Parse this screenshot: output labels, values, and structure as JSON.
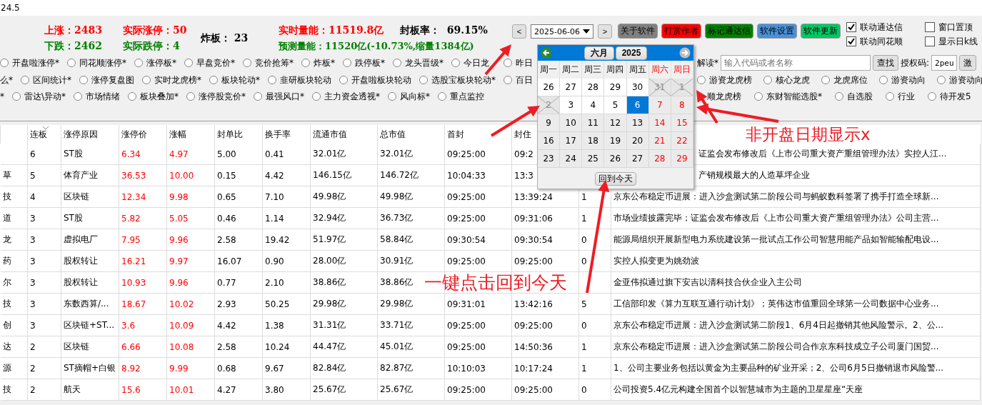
{
  "window": {
    "title": "24.5"
  },
  "market": {
    "rise": {
      "text": "上涨：2483",
      "kind": "up"
    },
    "limit_up": {
      "text": "实际涨停：50",
      "kind": "up"
    },
    "broken": {
      "text": "炸板： 23",
      "kind": "neutral"
    },
    "volume": {
      "text": "实时量能：11519.8亿",
      "kind": "up"
    },
    "seal_rate": {
      "text": "封板率：  69.15%",
      "kind": "neutral"
    },
    "fall": {
      "text": "下跌：2462",
      "kind": "down"
    },
    "limit_down": {
      "text": "实际跌停：4",
      "kind": "down"
    },
    "forecast": {
      "text": "预测量能：11520亿(-10.73%,缩量1384亿)",
      "kind": "down"
    }
  },
  "date_picker": {
    "prev": "<",
    "value": "2025-06-06",
    "next": ">"
  },
  "buttons": [
    {
      "label": "关于软件",
      "color": "#808080"
    },
    {
      "label": "打赏作者",
      "color": "#ff0000"
    },
    {
      "label": "标记通达信",
      "color": "#008000"
    },
    {
      "label": "软件设置",
      "color": "#4a90d9"
    },
    {
      "label": "软件更新",
      "color": "#00c864"
    }
  ],
  "checkboxes": [
    {
      "label": "联动通达信",
      "checked": true
    },
    {
      "label": "联动同花顺",
      "checked": true
    },
    {
      "label": "窗口置顶",
      "checked": false
    },
    {
      "label": "显示日k线",
      "checked": false
    }
  ],
  "radio_rows": [
    {
      "left": [
        {
          "kind": "radio",
          "label": "开盘啦涨停*",
          "selected": false
        },
        {
          "kind": "radio",
          "label": "同花顺涨停*",
          "selected": false
        },
        {
          "kind": "radio",
          "label": "涨停板*",
          "selected": false
        },
        {
          "kind": "radio",
          "label": "早盘竞价*",
          "selected": false
        },
        {
          "kind": "radio",
          "label": "竞价抢筹*",
          "selected": false
        },
        {
          "kind": "radio",
          "label": "炸板*",
          "selected": false
        },
        {
          "kind": "radio",
          "label": "跌停板*",
          "selected": false
        },
        {
          "kind": "radio",
          "label": "龙头晋级*",
          "selected": false
        },
        {
          "kind": "radio",
          "label": "今日龙",
          "selected": false
        },
        {
          "kind": "radio",
          "label": "昨日",
          "selected": false
        }
      ],
      "right": [
        {
          "kind": "text",
          "label": "解读*"
        },
        {
          "kind": "field",
          "placeholder": "输入代码或者名称"
        },
        {
          "kind": "button",
          "label": "查找"
        },
        {
          "kind": "text",
          "label": "授权码:"
        },
        {
          "kind": "field",
          "value": "2peu"
        },
        {
          "kind": "button",
          "label": "激"
        }
      ]
    },
    {
      "left": [
        {
          "kind": "text",
          "label": "么*"
        },
        {
          "kind": "radio",
          "label": "区间统计*",
          "selected": false
        },
        {
          "kind": "radio",
          "label": "涨停复盘图",
          "selected": false
        },
        {
          "kind": "radio",
          "label": "实时龙虎榜*",
          "selected": false
        },
        {
          "kind": "radio",
          "label": "板块轮动*",
          "selected": false
        },
        {
          "kind": "radio",
          "label": "韭研板块轮动",
          "selected": false
        },
        {
          "kind": "radio",
          "label": "开盘啦板块轮动",
          "selected": false
        },
        {
          "kind": "radio",
          "label": "选股宝板块轮动*",
          "selected": false
        },
        {
          "kind": "radio",
          "label": "百日",
          "selected": false
        }
      ],
      "right": [
        {
          "kind": "radio",
          "label": "游资龙虎榜",
          "selected": false
        },
        {
          "kind": "radio",
          "label": "核心龙虎",
          "selected": false
        },
        {
          "kind": "radio",
          "label": "龙虎席位",
          "selected": false
        },
        {
          "kind": "radio",
          "label": "游资动向",
          "selected": false
        },
        {
          "kind": "radio",
          "label": "游资动向",
          "selected": false
        }
      ]
    },
    {
      "left": [
        {
          "kind": "text",
          "label": "*"
        },
        {
          "kind": "radio",
          "label": "雷达\\异动*",
          "selected": false
        },
        {
          "kind": "radio",
          "label": "市场情绪",
          "selected": false
        },
        {
          "kind": "radio",
          "label": "板块叠加*",
          "selected": false
        },
        {
          "kind": "radio",
          "label": "涨停股竞价*",
          "selected": false
        },
        {
          "kind": "radio",
          "label": "最强风口*",
          "selected": false
        },
        {
          "kind": "radio",
          "label": "主力资金透视*",
          "selected": false
        },
        {
          "kind": "radio",
          "label": "风向标*",
          "selected": false
        },
        {
          "kind": "radio",
          "label": "重点监控",
          "selected": false
        }
      ],
      "right": [
        {
          "kind": "text",
          "label": "顺龙虎榜"
        },
        {
          "kind": "radio",
          "label": "东财智能选股*",
          "selected": false
        },
        {
          "kind": "radio",
          "label": "自选股",
          "selected": false
        },
        {
          "kind": "radio",
          "label": "行业",
          "selected": false
        },
        {
          "kind": "radio",
          "label": "待开发5",
          "selected": false
        }
      ]
    }
  ],
  "calendar": {
    "month": "六月",
    "year": "2025",
    "weekdays": [
      "周一",
      "周二",
      "周三",
      "周四",
      "周五",
      "周六",
      "周日"
    ],
    "weeks": [
      [
        {
          "label": "26",
          "kind": "past",
          "selected": false
        },
        {
          "label": "27",
          "kind": "past",
          "selected": false
        },
        {
          "label": "28",
          "kind": "past",
          "selected": false
        },
        {
          "label": "29",
          "kind": "past",
          "selected": false
        },
        {
          "label": "30",
          "kind": "past",
          "selected": false
        },
        {
          "label": "31",
          "kind": "closed",
          "selected": false
        },
        {
          "label": "1",
          "kind": "closed",
          "selected": false
        }
      ],
      [
        {
          "label": "2",
          "kind": "closed",
          "selected": false
        },
        {
          "label": "3",
          "kind": "past",
          "selected": false
        },
        {
          "label": "4",
          "kind": "past",
          "selected": false
        },
        {
          "label": "5",
          "kind": "past",
          "selected": false
        },
        {
          "label": "6",
          "kind": "past",
          "selected": true
        },
        {
          "label": "7",
          "kind": "future",
          "selected": false
        },
        {
          "label": "8",
          "kind": "future",
          "selected": false
        }
      ],
      [
        {
          "label": "9",
          "kind": "future",
          "selected": false
        },
        {
          "label": "10",
          "kind": "future",
          "selected": false
        },
        {
          "label": "11",
          "kind": "future",
          "selected": false
        },
        {
          "label": "12",
          "kind": "future",
          "selected": false
        },
        {
          "label": "13",
          "kind": "future",
          "selected": false
        },
        {
          "label": "14",
          "kind": "future",
          "selected": false
        },
        {
          "label": "15",
          "kind": "future",
          "selected": false
        }
      ],
      [
        {
          "label": "16",
          "kind": "future",
          "selected": false
        },
        {
          "label": "17",
          "kind": "future",
          "selected": false
        },
        {
          "label": "18",
          "kind": "future",
          "selected": false
        },
        {
          "label": "19",
          "kind": "future",
          "selected": false
        },
        {
          "label": "20",
          "kind": "future",
          "selected": false
        },
        {
          "label": "21",
          "kind": "future",
          "selected": false
        },
        {
          "label": "22",
          "kind": "future",
          "selected": false
        }
      ],
      [
        {
          "label": "23",
          "kind": "future",
          "selected": false
        },
        {
          "label": "24",
          "kind": "future",
          "selected": false
        },
        {
          "label": "25",
          "kind": "future",
          "selected": false
        },
        {
          "label": "26",
          "kind": "future",
          "selected": false
        },
        {
          "label": "27",
          "kind": "future",
          "selected": false
        },
        {
          "label": "28",
          "kind": "future",
          "selected": false
        },
        {
          "label": "29",
          "kind": "future",
          "selected": false
        }
      ]
    ],
    "today_button": "回到今天"
  },
  "table": {
    "columns": [
      {
        "label": "连板",
        "kind": "plain"
      },
      {
        "label": "涨停原因",
        "kind": "plain"
      },
      {
        "label": "涨停价",
        "kind": "change"
      },
      {
        "label": "涨幅",
        "kind": "change"
      },
      {
        "label": "封单比",
        "kind": "plain"
      },
      {
        "label": "换手率",
        "kind": "plain"
      },
      {
        "label": "流通市值",
        "kind": "plain"
      },
      {
        "label": "总市值",
        "kind": "plain"
      },
      {
        "label": "首封",
        "kind": "plain"
      },
      {
        "label": "封住",
        "kind": "plain"
      }
    ],
    "rows": [
      {
        "cells": [
          "6",
          "ST股",
          "6.34",
          "4.97",
          "5.00",
          "0.41",
          "32.01亿",
          "32.01亿",
          "09:25:00",
          "09:2",
          null,
          "证监会发布修改后《上市公司重大资产重组管理办法》实控人江..."
        ]
      },
      {
        "name": "草",
        "cells": [
          "5",
          "体育产业",
          "36.53",
          "10.00",
          "0.15",
          "4.42",
          "146.15亿",
          "146.72亿",
          "10:04:33",
          "13:3",
          null,
          "产销规模最大的人造草坪企业"
        ]
      },
      {
        "name": "技",
        "cells": [
          "4",
          "区块链",
          "12.34",
          "9.98",
          "0.65",
          "7.10",
          "49.98亿",
          "49.98亿",
          "09:25:00",
          "13:39:24",
          "1",
          "京东公布稳定币进展：进入沙盒测试第二阶段公司与蚂蚁数科签署了携手打造全球新..."
        ]
      },
      {
        "name": "道",
        "cells": [
          "3",
          "ST股",
          "5.82",
          "5.05",
          "0.46",
          "1.14",
          "32.94亿",
          "36.73亿",
          "09:25:00",
          "09:31:06",
          "1",
          "市场业绩披露完毕；证监会发布修改后《上市公司重大资产重组管理办法》公司主营..."
        ]
      },
      {
        "name": "龙",
        "cells": [
          "3",
          "虚拟电厂",
          "7.95",
          "9.96",
          "2.58",
          "19.42",
          "51.97亿",
          "58.84亿",
          "09:30:54",
          "09:30:54",
          "0",
          "能源局组织开展新型电力系统建设第一批试点工作公司智慧用能产品如智能输配电设..."
        ]
      },
      {
        "name": "药",
        "cells": [
          "3",
          "股权转让",
          "16.21",
          "9.97",
          "16.07",
          "0.90",
          "28.00亿",
          "30.91亿",
          "09:25:00",
          "09:25:00",
          "0",
          "实控人拟变更为姚劲波"
        ]
      },
      {
        "name": "尔",
        "cells": [
          "3",
          "股权转让",
          "10.93",
          "9.96",
          "0.77",
          "2.10",
          "38.86亿",
          "38.86亿",
          null,
          null,
          null,
          "金亚伟拟通过旗下安吉以清科技合伙企业入主公司"
        ]
      },
      {
        "name": "技",
        "cells": [
          "3",
          "东数西算/...",
          "18.67",
          "10.02",
          "2.93",
          "50.25",
          "29.98亿",
          "29.98亿",
          "09:31:01",
          "13:42:16",
          "5",
          "工信部印发《算力互联互通行动计划》；英伟达市值重回全球第一公司数据中心业务..."
        ]
      },
      {
        "name": "创",
        "cells": [
          "3",
          "区块链+ST...",
          "3.6",
          "10.09",
          "4.42",
          "1.38",
          "31.31亿",
          "33.71亿",
          "09:25:00",
          "09:25:00",
          "0",
          "京东公布稳定币进展：进入沙盒测试第二阶段1、6月4日起撤销其他风险警示。2、公..."
        ]
      },
      {
        "name": "达",
        "cells": [
          "2",
          "区块链",
          "6.66",
          "10.08",
          "2.58",
          "10.24",
          "44.47亿",
          "45.01亿",
          "09:25:00",
          "14:50:36",
          "1",
          "京东公布稳定币进展：进入沙盒测试第二阶段公司合作京东科技成立子公司厦门国贸..."
        ]
      },
      {
        "name": "源",
        "cells": [
          "2",
          "ST摘帽+白银",
          "8.92",
          "9.99",
          "0.68",
          "9.67",
          "82.84亿",
          "82.87亿",
          "10:10:03",
          "10:17:24",
          "1",
          "1、公司主要业务包括以黄金为主要品种的矿业开采；2、公司6月5日撤销退市风险警..."
        ]
      },
      {
        "name": "技",
        "cells": [
          "2",
          "航天",
          "15.6",
          "10.01",
          "4.27",
          "3.80",
          "25.67亿",
          "25.67亿",
          "09:25:00",
          "09:25:00",
          "0",
          "公司投资5.4亿元构建全国首个以智慧城市为主题的卫星星座“天座"
        ]
      }
    ]
  },
  "annotations": [
    {
      "text": "非开盘日期显示x",
      "kind": "closed-days"
    },
    {
      "text": "一键点击回到今天",
      "kind": "today"
    }
  ]
}
